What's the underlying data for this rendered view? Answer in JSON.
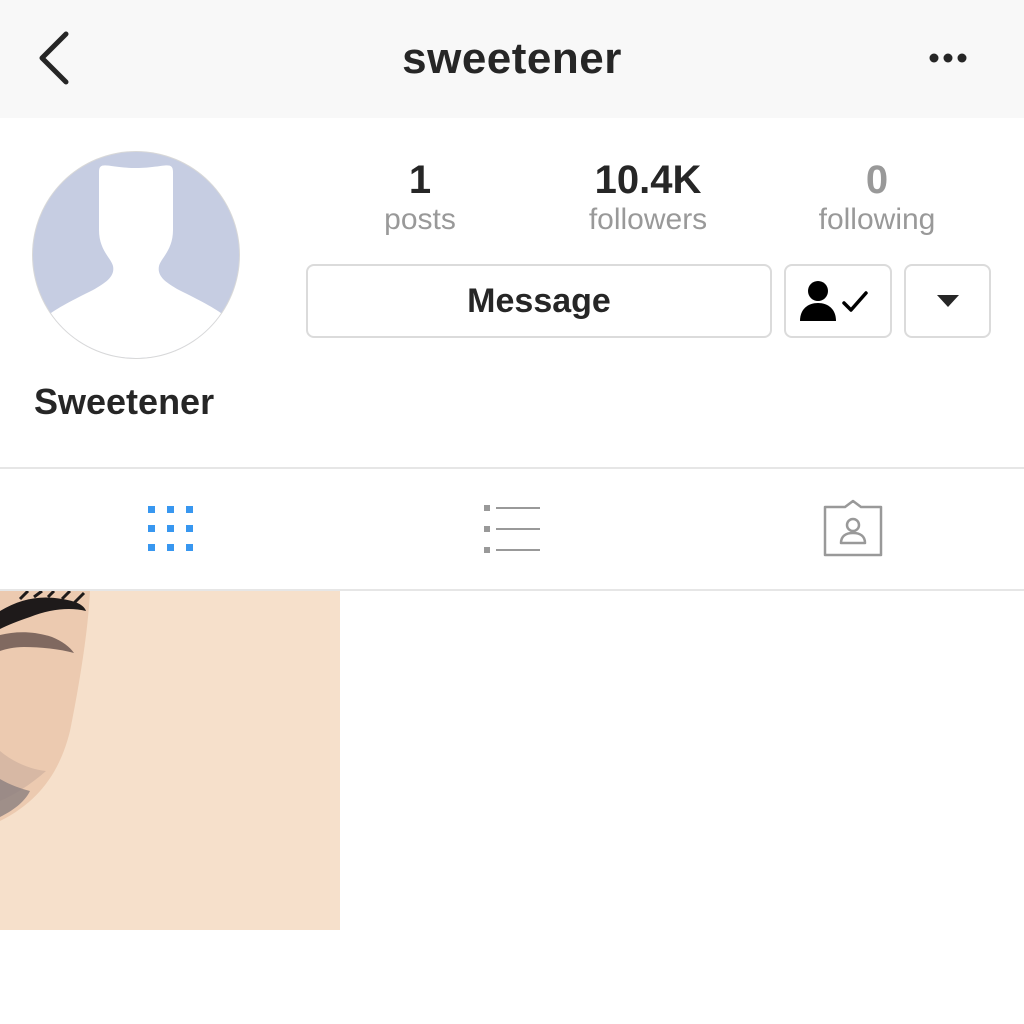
{
  "header": {
    "title": "sweetener",
    "back_icon": "chevron-left-icon",
    "more_icon": "more-options-icon"
  },
  "profile": {
    "display_name": "Sweetener",
    "avatar_icon": "default-avatar-icon"
  },
  "stats": {
    "posts": {
      "value": "1",
      "label": "posts"
    },
    "followers": {
      "value": "10.4K",
      "label": "followers"
    },
    "following": {
      "value": "0",
      "label": "following"
    }
  },
  "actions": {
    "message_label": "Message",
    "following_icon": "person-check-icon",
    "dropdown_icon": "triangle-down-icon"
  },
  "tabs": [
    {
      "name": "grid",
      "icon": "grid-icon",
      "active": true
    },
    {
      "name": "list",
      "icon": "list-icon",
      "active": false
    },
    {
      "name": "tagged",
      "icon": "tagged-icon",
      "active": false
    }
  ],
  "colors": {
    "accent": "#3897f0",
    "text": "#262626",
    "muted": "#999999",
    "border": "#dbdbdb",
    "header_bg": "#f8f8f8"
  },
  "posts": [
    {
      "thumbnail": "face-closeup-photo"
    }
  ]
}
